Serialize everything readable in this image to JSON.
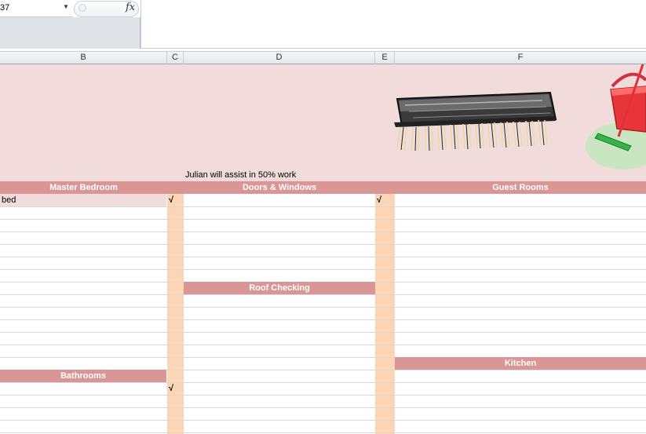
{
  "formula_bar": {
    "name_box": "37",
    "fx_label": "fx"
  },
  "columns": [
    "B",
    "C",
    "D",
    "E",
    "F"
  ],
  "banner": {
    "note": "Julian will assist in 50% work"
  },
  "sections": {
    "master_bedroom": "Master Bedroom",
    "doors_windows": "Doors & Windows",
    "guest_rooms": "Guest Rooms",
    "roof_checking": "Roof Checking",
    "bathrooms": "Bathrooms",
    "kitchen": "Kitchen"
  },
  "cells": {
    "b_first": "bed",
    "check_mark": "√"
  },
  "icons": [
    "scrub-brush-clipart",
    "mop-bucket-clipart",
    "dropdown-arrow-icon",
    "fx-icon"
  ],
  "colors": {
    "banner_bg": "#f2dcdb",
    "section_header": "#da9694",
    "checkbox_column": "#fcd5b4"
  }
}
